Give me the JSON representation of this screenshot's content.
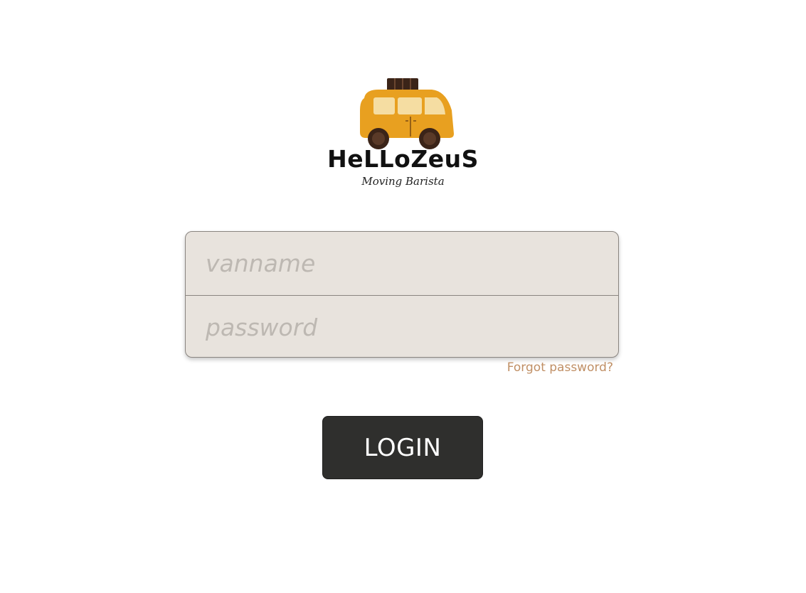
{
  "brand": {
    "name": "HeLLoZeuS",
    "tagline": "Moving Barista",
    "logo_icon": "van-icon",
    "logo_color": "#e8a020"
  },
  "login_form": {
    "username_placeholder": "vanname",
    "username_value": "",
    "password_placeholder": "password",
    "password_value": "",
    "forgot_label": "Forgot password?",
    "submit_label": "LOGIN"
  },
  "colors": {
    "field_bg": "#e8e3dd",
    "link": "#c08f65",
    "button_bg": "#2f2f2d"
  }
}
